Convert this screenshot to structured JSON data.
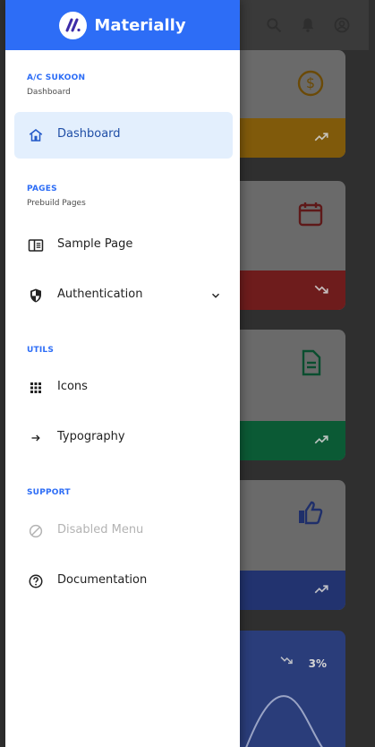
{
  "app": {
    "name": "Materially"
  },
  "sections": [
    {
      "title": "A/C SUKOON",
      "subtitle": "Dashboard"
    },
    {
      "title": "PAGES",
      "subtitle": "Prebuild Pages"
    },
    {
      "title": "UTILS"
    },
    {
      "title": "SUPPORT"
    }
  ],
  "menu": [
    {
      "label": "Dashboard",
      "icon": "home-icon",
      "active": true
    },
    {
      "label": "Sample Page",
      "icon": "chrome-reader-icon"
    },
    {
      "label": "Authentication",
      "icon": "security-icon",
      "has_children": true
    },
    {
      "label": "Icons",
      "icon": "apps-grid-icon"
    },
    {
      "label": "Typography",
      "icon": "arrow-right-icon"
    },
    {
      "label": "Disabled Menu",
      "icon": "block-icon",
      "disabled": true
    },
    {
      "label": "Documentation",
      "icon": "help-circle-icon"
    }
  ],
  "overlay_content": {
    "percent_badge": "3%"
  },
  "colors": {
    "primary": "#2d6df6",
    "active_bg": "#e3effd",
    "amber": "#d48b0a",
    "red": "#c62828",
    "green": "#0e8f55",
    "blue": "#2d4ec5"
  }
}
